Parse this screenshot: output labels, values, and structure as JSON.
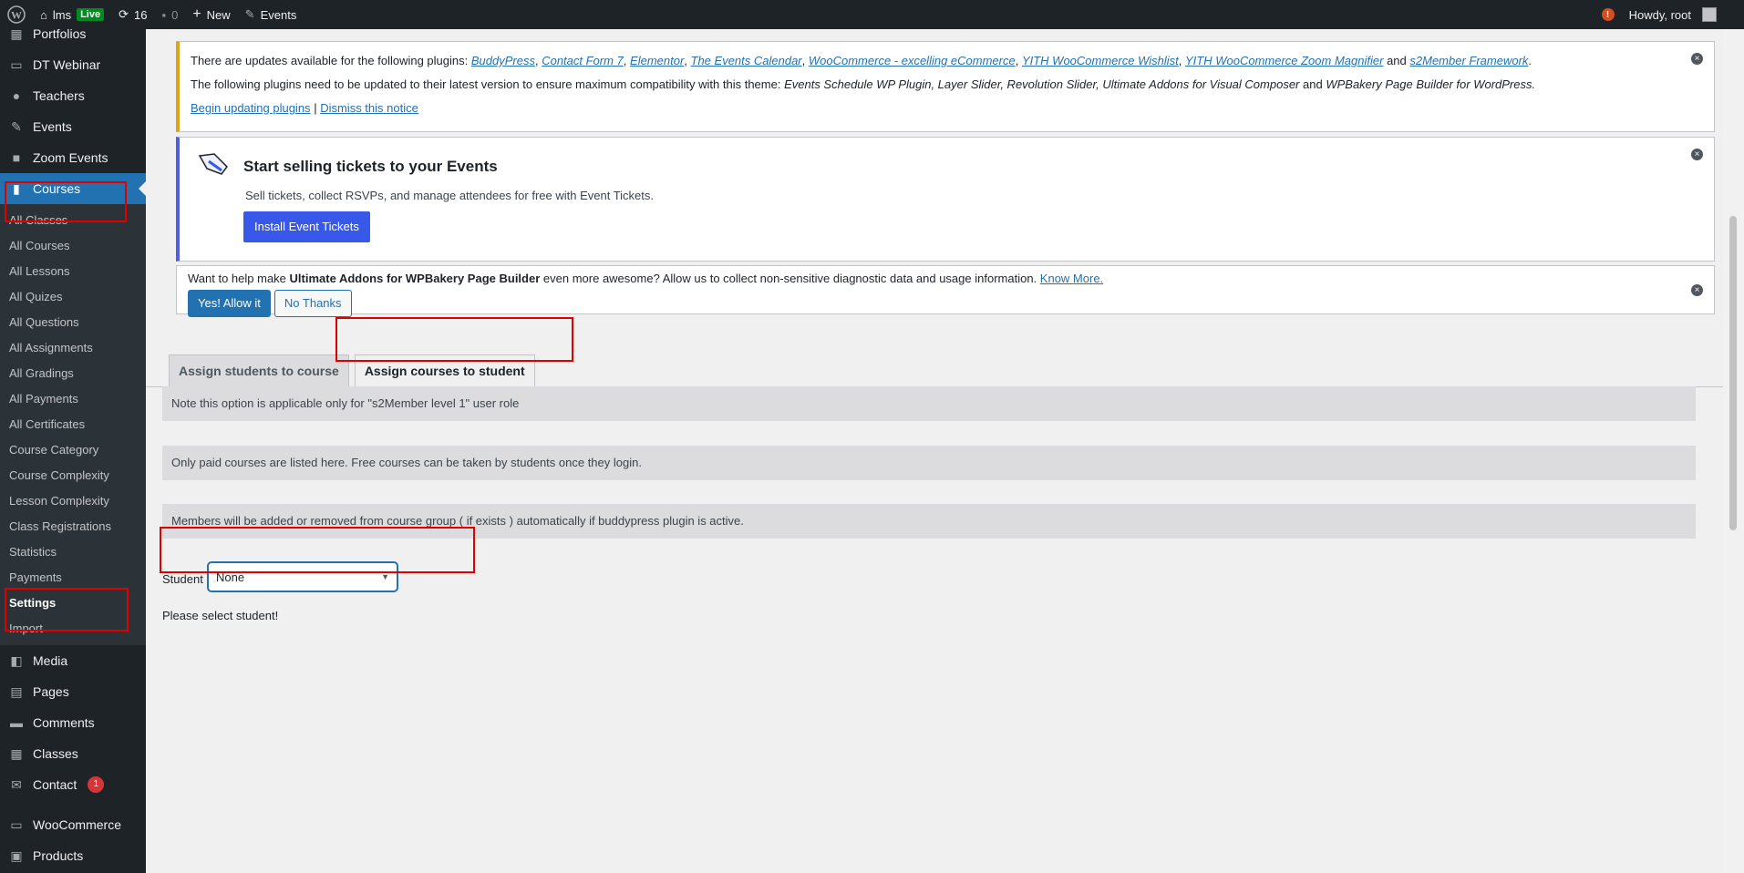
{
  "adminbar": {
    "site_name": "lms",
    "live_label": "Live",
    "updates_count": "16",
    "comments_count": "0",
    "new_label": "New",
    "events_label": "Events",
    "notification_mark": "!",
    "greeting": "Howdy, root"
  },
  "sidebar": {
    "top_items": [
      {
        "label": "Portfolios",
        "icon": "portfolio-icon"
      },
      {
        "label": "DT Webinar",
        "icon": "webinar-icon"
      },
      {
        "label": "Teachers",
        "icon": "user-icon"
      },
      {
        "label": "Events",
        "icon": "ticket-icon"
      },
      {
        "label": "Zoom Events",
        "icon": "video-icon"
      },
      {
        "label": "Courses",
        "icon": "book-icon"
      }
    ],
    "courses_submenu": [
      "All Classes",
      "All Courses",
      "All Lessons",
      "All Quizes",
      "All Questions",
      "All Assignments",
      "All Gradings",
      "All Payments",
      "All Certificates",
      "Course Category",
      "Course Complexity",
      "Lesson Complexity",
      "Class Registrations",
      "Statistics",
      "Payments",
      "Settings",
      "Import"
    ],
    "bottom_items": [
      {
        "label": "Media",
        "icon": "media-icon"
      },
      {
        "label": "Pages",
        "icon": "page-icon"
      },
      {
        "label": "Comments",
        "icon": "comment-icon"
      },
      {
        "label": "Classes",
        "icon": "calendar-icon"
      },
      {
        "label": "Contact",
        "icon": "mail-icon",
        "badge": "1"
      },
      {
        "label": "WooCommerce",
        "icon": "woo-icon"
      },
      {
        "label": "Products",
        "icon": "product-icon"
      }
    ]
  },
  "notices": {
    "plugins": {
      "intro": "There are updates available for the following plugins:",
      "plugin_links": [
        "BuddyPress",
        "Contact Form 7",
        "Elementor",
        "The Events Calendar",
        "WooCommerce - excelling eCommerce",
        "YITH WooCommerce Wishlist",
        "YITH WooCommerce Zoom Magnifier"
      ],
      "and_word": "and",
      "last_plugin": "s2Member Framework",
      "required_intro": "The following plugins need to be updated to their latest version to ensure maximum compatibility with this theme:",
      "required_list": "Events Schedule WP Plugin, Layer Slider, Revolution Slider, Ultimate Addons for Visual Composer",
      "required_and": "and",
      "required_last": "WPBakery Page Builder for WordPress.",
      "begin_link": "Begin updating plugins",
      "separator": "|",
      "dismiss_link": "Dismiss this notice"
    },
    "tickets": {
      "title": "Start selling tickets to your Events",
      "text": "Sell tickets, collect RSVPs, and manage attendees for free with Event Tickets.",
      "button": "Install Event Tickets"
    },
    "ultimate": {
      "text_before": "Want to help make",
      "product": "Ultimate Addons for WPBakery Page Builder",
      "text_after": "even more awesome? Allow us to collect non-sensitive diagnostic data and usage information.",
      "know_more": "Know More.",
      "allow_button": "Yes! Allow it",
      "no_button": "No Thanks"
    }
  },
  "tabs": [
    {
      "label": "Assign students to course",
      "active": false
    },
    {
      "label": "Assign courses to student",
      "active": true
    }
  ],
  "info_boxes": [
    "Note this option is applicable only for \"s2Member level 1\" user role",
    "Only paid courses are listed here. Free courses can be taken by students once they login.",
    "Members will be added or removed from course group ( if exists ) automatically if buddypress plugin is active."
  ],
  "student_field": {
    "label": "Student",
    "selected": "None",
    "message": "Please select student!"
  }
}
